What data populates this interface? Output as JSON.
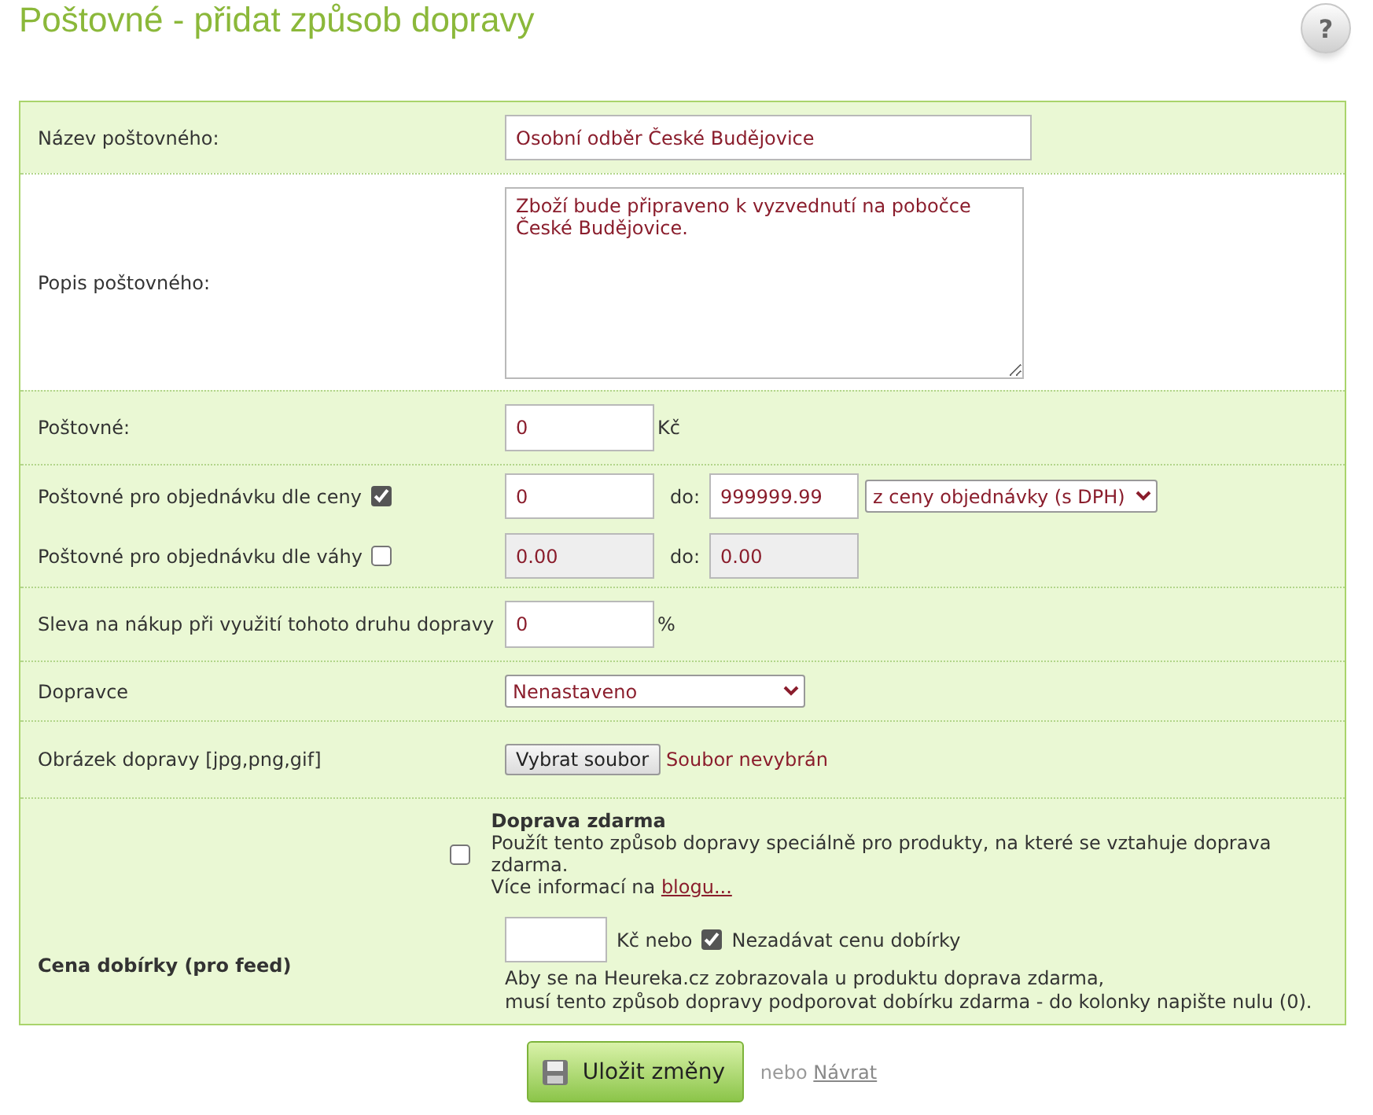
{
  "title": "Poštovné - přidat způsob dopravy",
  "help": {
    "label": "?"
  },
  "fields": [
    {
      "kind": "text",
      "label": "Název poštovného:",
      "value": "Osobní odběr České Budějovice"
    },
    {
      "kind": "textarea",
      "label": "Popis poštovného:",
      "value": "Zboží bude připraveno k vyzvednutí na pobočce České Budějovice."
    },
    {
      "kind": "amount",
      "label": "Poštovné:",
      "value": "0",
      "unit": "Kč"
    },
    {
      "kind": "ranges",
      "ranges": [
        {
          "label": "Poštovné pro objednávku dle ceny",
          "checked": true,
          "from": "0",
          "to_label": "do:",
          "to": "999999.99",
          "select": "z ceny objednávky (s DPH)"
        },
        {
          "label": "Poštovné pro objednávku dle váhy",
          "checked": false,
          "from": "0.00",
          "to_label": "do:",
          "to": "0.00"
        }
      ]
    },
    {
      "kind": "amount",
      "label": "Sleva na nákup při využití tohoto druhu dopravy",
      "value": "0",
      "unit": "%"
    },
    {
      "kind": "select",
      "label": "Dopravce",
      "value": "Nenastaveno"
    },
    {
      "kind": "file",
      "label": "Obrázek dopravy [jpg,png,gif]",
      "button": "Vybrat soubor",
      "status": "Soubor nevybrán"
    },
    {
      "kind": "cod",
      "label": "Cena dobírky (pro feed)",
      "free": {
        "checked": false,
        "title": "Doprava zdarma",
        "text": "Použít tento způsob dopravy speciálně pro produkty, na které se vztahuje doprava zdarma.",
        "more": "Více informací na",
        "link": "blogu..."
      },
      "unit": "Kč nebo",
      "skip": {
        "checked": true,
        "label": "Nezadávat cenu dobírky"
      },
      "note": [
        "Aby se na Heureka.cz zobrazovala u produktu doprava zdarma,",
        "musí tento způsob dopravy podporovat dobírku zdarma - do kolonky napište nulu (0)."
      ]
    }
  ],
  "footer": {
    "save": "Uložit změny",
    "or": "nebo",
    "back": "Návrat"
  }
}
